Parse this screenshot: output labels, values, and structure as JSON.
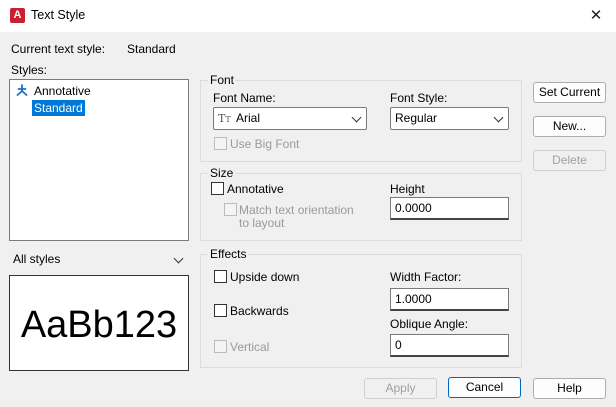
{
  "window": {
    "title": "Text Style",
    "app_icon_letter": "A",
    "close_glyph": "✕"
  },
  "current_style": {
    "label": "Current text style:",
    "value": "Standard"
  },
  "styles": {
    "label": "Styles:",
    "items": [
      {
        "label": "Annotative",
        "icon": "annotative-icon"
      },
      {
        "label": "Standard",
        "selected": true
      }
    ],
    "filter": {
      "value": "All styles"
    },
    "preview_text": "AaBb123"
  },
  "font": {
    "group_label": "Font",
    "font_name_label": "Font Name:",
    "font_name_value": "Arial",
    "font_name_icon": "truetype-font-icon",
    "font_style_label": "Font Style:",
    "font_style_value": "Regular",
    "use_big_font_label": "Use Big Font"
  },
  "size": {
    "group_label": "Size",
    "annotative_label": "Annotative",
    "match_orientation_label_1": "Match text orientation",
    "match_orientation_label_2": "to layout",
    "height_label": "Height",
    "height_value": "0.0000"
  },
  "effects": {
    "group_label": "Effects",
    "upside_down_label": "Upside down",
    "backwards_label": "Backwards",
    "vertical_label": "Vertical",
    "width_factor_label": "Width Factor:",
    "width_factor_value": "1.0000",
    "oblique_angle_label": "Oblique Angle:",
    "oblique_angle_value": "0"
  },
  "buttons": {
    "set_current": "Set Current",
    "new": "New...",
    "delete": "Delete",
    "apply": "Apply",
    "cancel": "Cancel",
    "help": "Help"
  },
  "colors": {
    "selection": "#0078d7",
    "app_icon": "#c8202f",
    "default_button_border": "#0067c0"
  }
}
